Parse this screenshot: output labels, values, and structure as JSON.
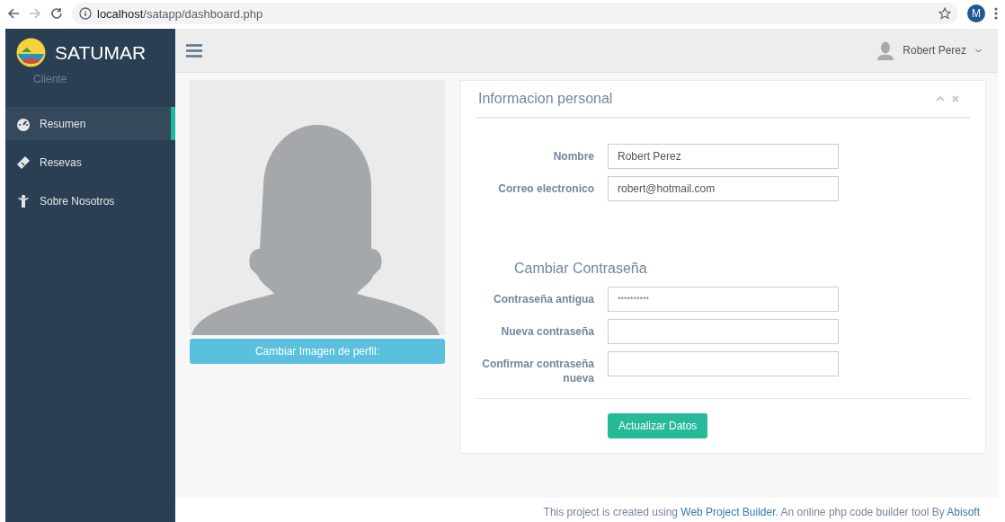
{
  "browser": {
    "url_host": "localhost",
    "url_path": "/satapp/dashboard.php",
    "profile_initial": "M"
  },
  "sidebar": {
    "brand": "SATUMAR",
    "role": "Cliente",
    "items": [
      {
        "label": "Resumen",
        "kind": "gauge",
        "selected": true
      },
      {
        "label": "Resevas",
        "kind": "ticket",
        "selected": false
      },
      {
        "label": "Sobre Nosotros",
        "kind": "person",
        "selected": false
      }
    ]
  },
  "topbar": {
    "user": "Robert Perez"
  },
  "profile": {
    "button": "Cambiar Imagen de perfil:"
  },
  "card": {
    "title": "Informacion personal",
    "fields": [
      {
        "label": "Nombre",
        "value": "Robert Perez"
      },
      {
        "label": "Correo electronico",
        "value": "robert@hotmail.com"
      }
    ],
    "section_title": "Cambiar Contraseña",
    "password_fields": [
      {
        "label": "Contraseña antigua",
        "placeholder": "**********"
      },
      {
        "label": "Nueva contraseña"
      },
      {
        "label": "Confirmar contraseña nueva"
      }
    ],
    "submit": "Actualizar Datos"
  },
  "footer": {
    "text_before": "This project is created using ",
    "link1": "Web Project Builder",
    "text_middle": ". An online php code builder tool By ",
    "link2": "Abisoft"
  }
}
